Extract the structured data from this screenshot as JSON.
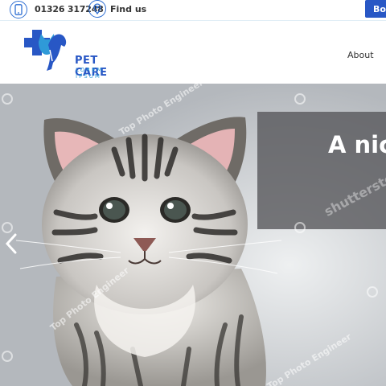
{
  "topbar": {
    "phone": "01326 317248",
    "find_us": "Find us",
    "book_label": "Boo",
    "icons": [
      "phone-icon",
      "map-pin-icon"
    ]
  },
  "header": {
    "logo_title": "PET CARE",
    "logo_subtitle": "LOREM IPSUM",
    "nav": {
      "about": "About"
    }
  },
  "hero": {
    "caption": "A nice",
    "watermarks": [
      "Top Photo Engineer",
      "Top Photo Engineer",
      "Top Photo Engineer",
      "shutterstock"
    ]
  },
  "colors": {
    "brand_blue": "#2857c5",
    "accent_light_blue": "#2f9ad8",
    "caption_bg": "#555558"
  }
}
